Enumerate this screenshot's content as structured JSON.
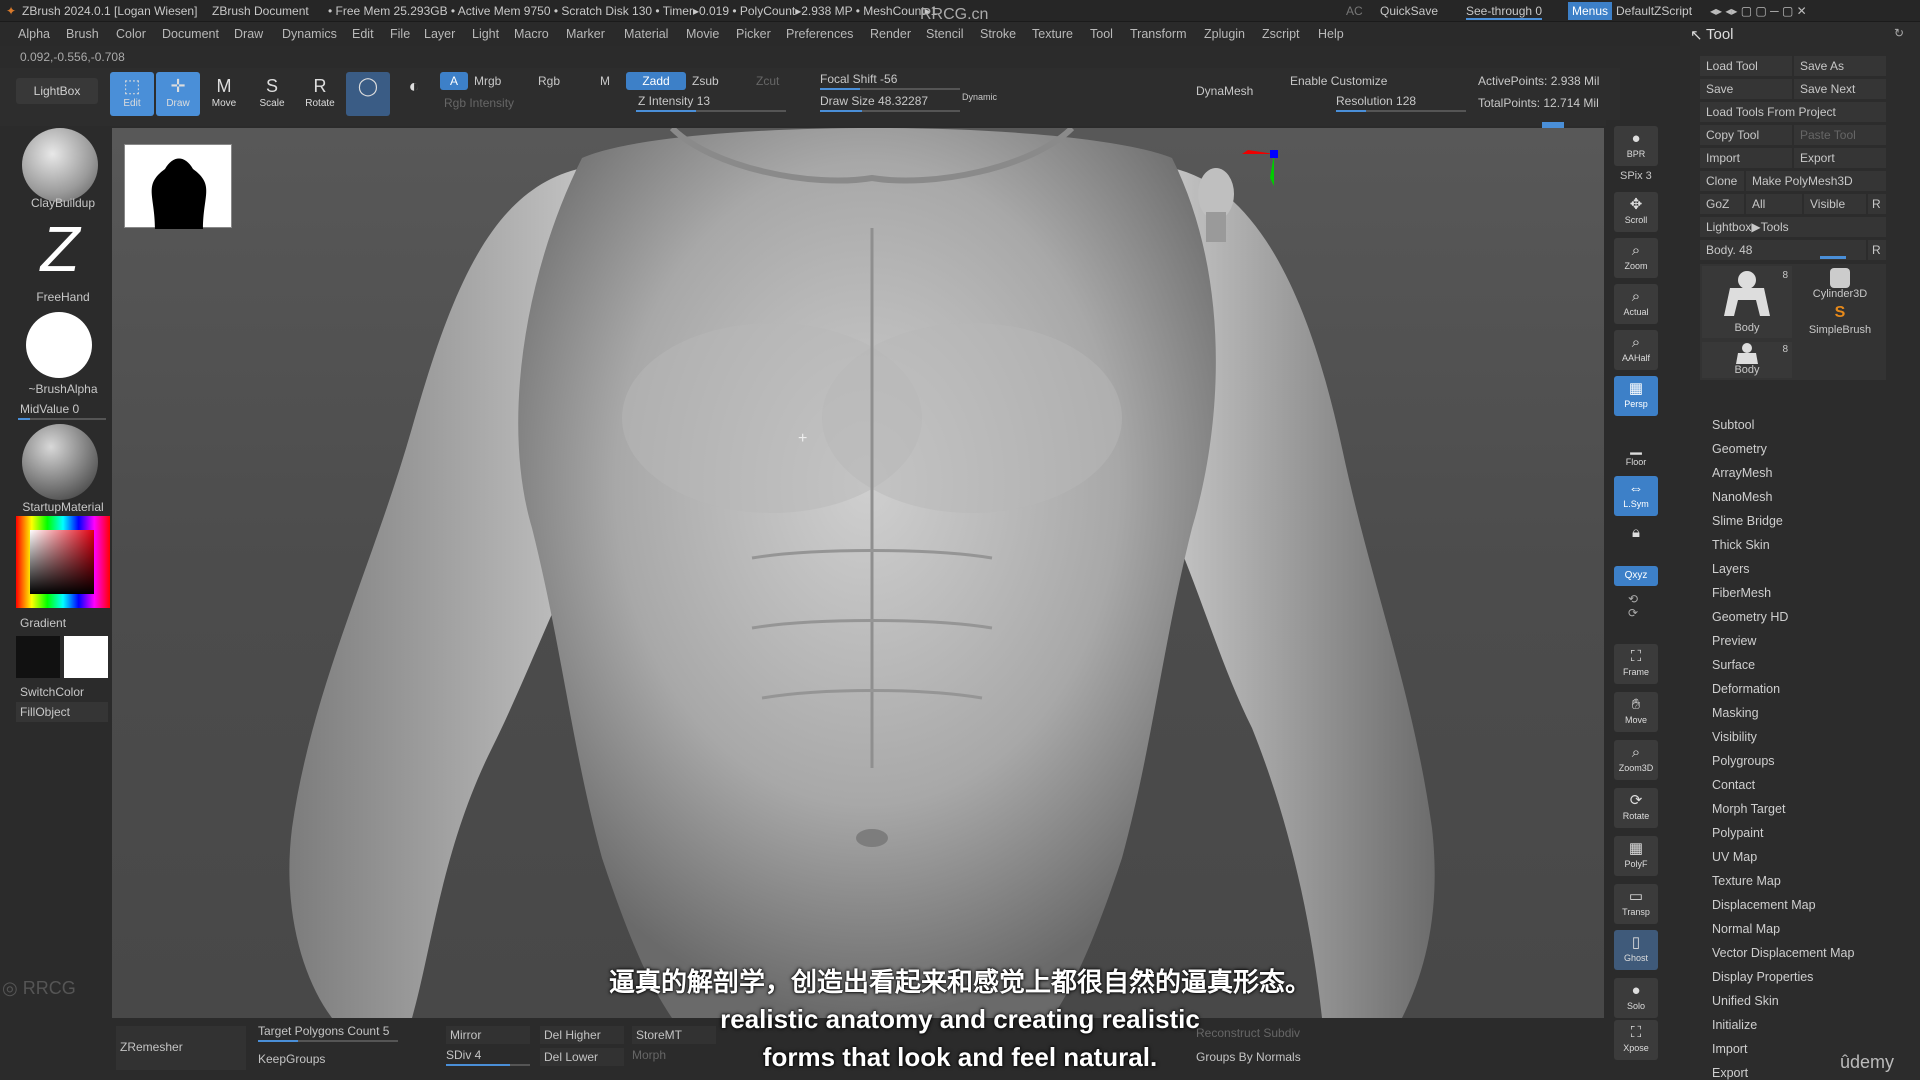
{
  "titlebar": {
    "app": "ZBrush 2024.0.1 [Logan Wiesen]",
    "document": "ZBrush Document",
    "stats": "• Free Mem 25.293GB • Active Mem 9750 • Scratch Disk 130 • Timer▸0.019 • PolyCount▸2.938 MP • MeshCount▸1",
    "watermark": "RRCG.cn",
    "ac": "AC",
    "quicksave": "QuickSave",
    "see_through": "See-through  0",
    "menus": "Menus",
    "script": "DefaultZScript"
  },
  "menubar": [
    "Alpha",
    "Brush",
    "Color",
    "Document",
    "Draw",
    "Dynamics",
    "Edit",
    "File",
    "Layer",
    "Light",
    "Macro",
    "Marker",
    "Material",
    "Movie",
    "Picker",
    "Preferences",
    "Render",
    "Stencil",
    "Stroke",
    "Texture",
    "Tool",
    "Transform",
    "Zplugin",
    "Zscript",
    "Help"
  ],
  "coords": "0.092,-0.556,-0.708",
  "shelf": {
    "lightbox": "LightBox",
    "edit": "Edit",
    "draw": "Draw",
    "move": "Move",
    "scale": "Scale",
    "rotate": "Rotate",
    "a": "A",
    "mrgb": "Mrgb",
    "rgb": "Rgb",
    "m": "M",
    "zadd": "Zadd",
    "zsub": "Zsub",
    "zcut": "Zcut",
    "rgb_intensity": "Rgb Intensity",
    "z_intensity": "Z Intensity 13",
    "focal_shift": "Focal Shift -56",
    "draw_size": "Draw Size 48.32287",
    "dynamic": "Dynamic",
    "dynamesh": "DynaMesh",
    "enable_customize": "Enable Customize",
    "resolution": "Resolution 128",
    "active_points": "ActivePoints: 2.938 Mil",
    "total_points": "TotalPoints: 12.714 Mil"
  },
  "leftbar": {
    "brush": "ClayBuildup",
    "stroke": "FreeHand",
    "alpha": "~BrushAlpha",
    "midvalue": "MidValue 0",
    "material": "StartupMaterial",
    "gradient": "Gradient",
    "switchcolor": "SwitchColor",
    "fillobject": "FillObject"
  },
  "rightstrip": [
    "BPR",
    "SPix 3",
    "Scroll",
    "Zoom",
    "Actual",
    "AAHalf",
    "Persp",
    "Floor",
    "L.Sym",
    "Lock",
    "Qxyz",
    "Frame",
    "Move",
    "Zoom3D",
    "Rotate",
    "PolyF",
    "Transp",
    "Ghost",
    "Solo",
    "Xpose"
  ],
  "toolpanel": {
    "title": "Tool",
    "load_tool": "Load Tool",
    "save_as": "Save As",
    "save": "Save",
    "save_next": "Save Next",
    "load_from_project": "Load Tools From Project",
    "copy_tool": "Copy Tool",
    "paste_tool": "Paste Tool",
    "import": "Import",
    "export": "Export",
    "clone": "Clone",
    "make_polymesh": "Make PolyMesh3D",
    "goz": "GoZ",
    "all": "All",
    "visible": "Visible",
    "r": "R",
    "lightbox_tools": "Lightbox▶Tools",
    "body_slider": "Body. 48",
    "thumbs": [
      {
        "label": "Body",
        "count": "8"
      },
      {
        "label": "Cylinder3D",
        "count": ""
      },
      {
        "label": "SimpleBrush",
        "count": ""
      },
      {
        "label": "Body",
        "count": "8"
      }
    ],
    "menu": [
      "Subtool",
      "Geometry",
      "ArrayMesh",
      "NanoMesh",
      "Slime Bridge",
      "Thick Skin",
      "Layers",
      "FiberMesh",
      "Geometry HD",
      "Preview",
      "Surface",
      "Deformation",
      "Masking",
      "Visibility",
      "Polygroups",
      "Contact",
      "Morph Target",
      "Polypaint",
      "UV Map",
      "Texture Map",
      "Displacement Map",
      "Normal Map",
      "Vector Displacement Map",
      "Display Properties",
      "Unified Skin",
      "Initialize",
      "Import",
      "Export"
    ]
  },
  "bottombar": {
    "zremesher": "ZRemesher",
    "target_poly": "Target Polygons Count 5",
    "keepgroups": "KeepGroups",
    "mirror": "Mirror",
    "sdiv": "SDiv 4",
    "del_higher": "Del Higher",
    "del_lower": "Del Lower",
    "storemt": "StoreMT",
    "morph": "Morph",
    "reconstruct": "Reconstruct Subdiv",
    "groups_by_normals": "Groups By Normals",
    "udemy": "ûdemy"
  },
  "subtitles": {
    "zh": "逼真的解剖学，创造出看起来和感觉上都很自然的逼真形态。",
    "en1": "realistic anatomy and creating realistic",
    "en2": "forms that look and feel natural."
  },
  "colors": {
    "accent": "#3d80c8",
    "bg": "#2b2b2b"
  }
}
